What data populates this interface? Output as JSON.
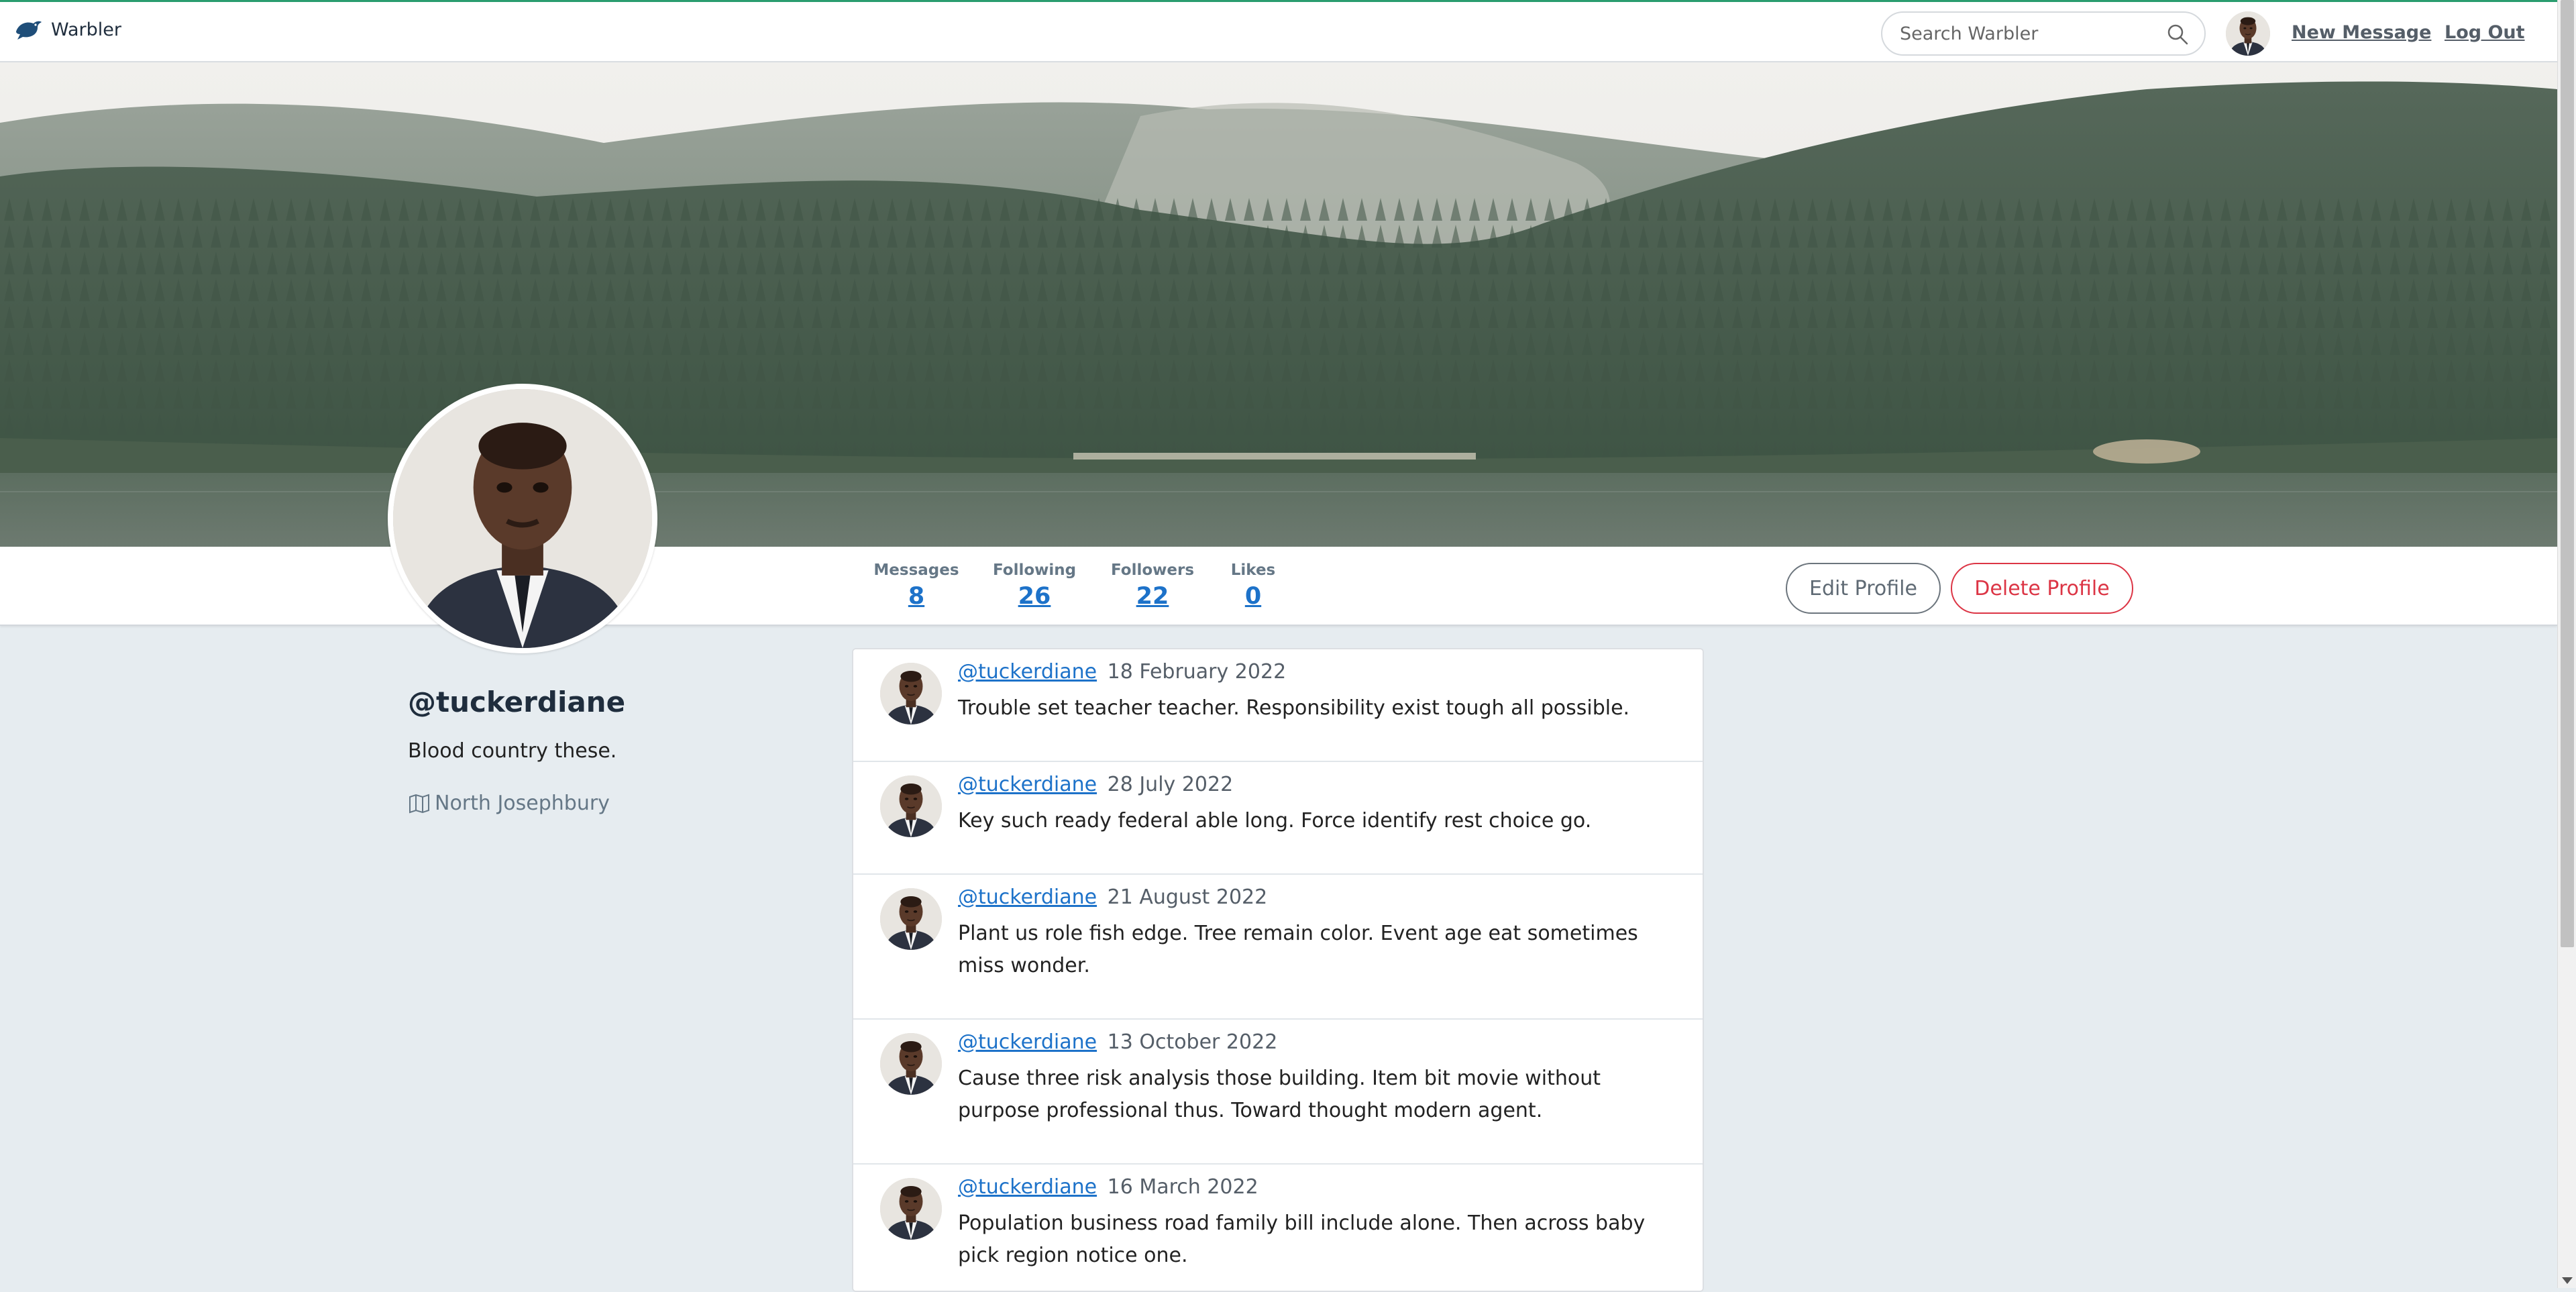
{
  "navbar": {
    "brand": "Warbler",
    "search_placeholder": "Search Warbler",
    "new_message": "New Message",
    "log_out": "Log Out"
  },
  "profile": {
    "username": "@tuckerdiane",
    "bio": "Blood country these.",
    "location": "North Josephbury"
  },
  "stats": [
    {
      "label": "Messages",
      "value": "8"
    },
    {
      "label": "Following",
      "value": "26"
    },
    {
      "label": "Followers",
      "value": "22"
    },
    {
      "label": "Likes",
      "value": "0"
    }
  ],
  "buttons": {
    "edit": "Edit Profile",
    "delete": "Delete Profile"
  },
  "messages": [
    {
      "user": "@tuckerdiane",
      "date": "18 February 2022",
      "text": "Trouble set teacher teacher. Responsibility exist tough all possible."
    },
    {
      "user": "@tuckerdiane",
      "date": "28 July 2022",
      "text": "Key such ready federal able long. Force identify rest choice go."
    },
    {
      "user": "@tuckerdiane",
      "date": "21 August 2022",
      "text": "Plant us role fish edge. Tree remain color. Event age eat sometimes miss wonder."
    },
    {
      "user": "@tuckerdiane",
      "date": "13 October 2022",
      "text": "Cause three risk analysis those building. Item bit movie without purpose professional thus. Toward thought modern agent."
    },
    {
      "user": "@tuckerdiane",
      "date": "16 March 2022",
      "text": "Population business road family bill include alone. Then across baby pick region notice one."
    }
  ],
  "colors": {
    "accent": "#2a9d6f",
    "link": "#1d72c9",
    "danger": "#dc3545",
    "page_bg": "#e6ecf0"
  }
}
